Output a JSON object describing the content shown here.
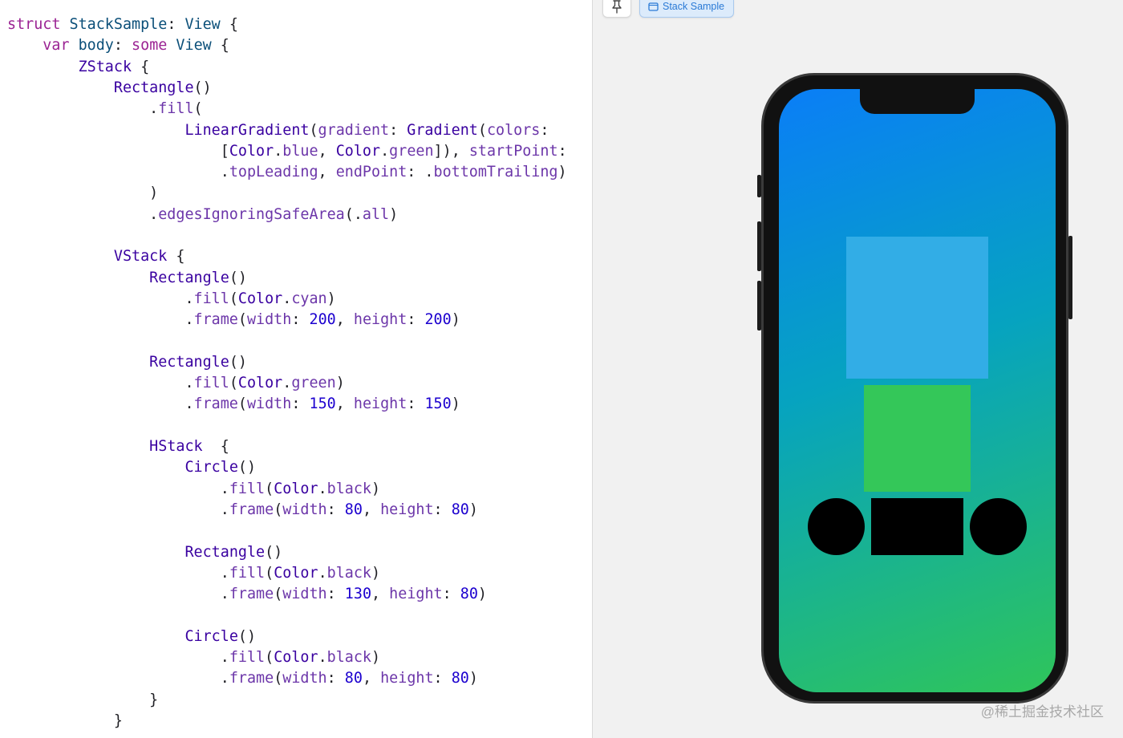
{
  "editor": {
    "lines": [
      [
        [
          "keyword",
          "struct"
        ],
        [
          "plain",
          " "
        ],
        [
          "type",
          "StackSample"
        ],
        [
          "plain",
          ": "
        ],
        [
          "type",
          "View"
        ],
        [
          "plain",
          " {"
        ]
      ],
      [
        [
          "plain",
          "    "
        ],
        [
          "keyword",
          "var"
        ],
        [
          "plain",
          " "
        ],
        [
          "type",
          "body"
        ],
        [
          "plain",
          ": "
        ],
        [
          "keyword",
          "some"
        ],
        [
          "plain",
          " "
        ],
        [
          "type",
          "View"
        ],
        [
          "plain",
          " {"
        ]
      ],
      [
        [
          "plain",
          "        "
        ],
        [
          "method",
          "ZStack"
        ],
        [
          "plain",
          " {"
        ]
      ],
      [
        [
          "plain",
          "            "
        ],
        [
          "method",
          "Rectangle"
        ],
        [
          "plain",
          "()"
        ]
      ],
      [
        [
          "plain",
          "                ."
        ],
        [
          "member",
          "fill"
        ],
        [
          "plain",
          "("
        ]
      ],
      [
        [
          "plain",
          "                    "
        ],
        [
          "method",
          "LinearGradient"
        ],
        [
          "plain",
          "("
        ],
        [
          "member",
          "gradient"
        ],
        [
          "plain",
          ": "
        ],
        [
          "method",
          "Gradient"
        ],
        [
          "plain",
          "("
        ],
        [
          "member",
          "colors"
        ],
        [
          "plain",
          ":"
        ]
      ],
      [
        [
          "plain",
          "                        ["
        ],
        [
          "method",
          "Color"
        ],
        [
          "plain",
          "."
        ],
        [
          "member",
          "blue"
        ],
        [
          "plain",
          ", "
        ],
        [
          "method",
          "Color"
        ],
        [
          "plain",
          "."
        ],
        [
          "member",
          "green"
        ],
        [
          "plain",
          "]), "
        ],
        [
          "member",
          "startPoint"
        ],
        [
          "plain",
          ":"
        ]
      ],
      [
        [
          "plain",
          "                        ."
        ],
        [
          "member",
          "topLeading"
        ],
        [
          "plain",
          ", "
        ],
        [
          "member",
          "endPoint"
        ],
        [
          "plain",
          ": ."
        ],
        [
          "member",
          "bottomTrailing"
        ],
        [
          "plain",
          ")"
        ]
      ],
      [
        [
          "plain",
          "                )"
        ]
      ],
      [
        [
          "plain",
          "                ."
        ],
        [
          "member",
          "edgesIgnoringSafeArea"
        ],
        [
          "plain",
          "(."
        ],
        [
          "member",
          "all"
        ],
        [
          "plain",
          ")"
        ]
      ],
      [
        [
          "plain",
          ""
        ]
      ],
      [
        [
          "plain",
          "            "
        ],
        [
          "method",
          "VStack"
        ],
        [
          "plain",
          " {"
        ]
      ],
      [
        [
          "plain",
          "                "
        ],
        [
          "method",
          "Rectangle"
        ],
        [
          "plain",
          "()"
        ]
      ],
      [
        [
          "plain",
          "                    ."
        ],
        [
          "member",
          "fill"
        ],
        [
          "plain",
          "("
        ],
        [
          "method",
          "Color"
        ],
        [
          "plain",
          "."
        ],
        [
          "member",
          "cyan"
        ],
        [
          "plain",
          ")"
        ]
      ],
      [
        [
          "plain",
          "                    ."
        ],
        [
          "member",
          "frame"
        ],
        [
          "plain",
          "("
        ],
        [
          "member",
          "width"
        ],
        [
          "plain",
          ": "
        ],
        [
          "number",
          "200"
        ],
        [
          "plain",
          ", "
        ],
        [
          "member",
          "height"
        ],
        [
          "plain",
          ": "
        ],
        [
          "number",
          "200"
        ],
        [
          "plain",
          ")"
        ]
      ],
      [
        [
          "plain",
          ""
        ]
      ],
      [
        [
          "plain",
          "                "
        ],
        [
          "method",
          "Rectangle"
        ],
        [
          "plain",
          "()"
        ]
      ],
      [
        [
          "plain",
          "                    ."
        ],
        [
          "member",
          "fill"
        ],
        [
          "plain",
          "("
        ],
        [
          "method",
          "Color"
        ],
        [
          "plain",
          "."
        ],
        [
          "member",
          "green"
        ],
        [
          "plain",
          ")"
        ]
      ],
      [
        [
          "plain",
          "                    ."
        ],
        [
          "member",
          "frame"
        ],
        [
          "plain",
          "("
        ],
        [
          "member",
          "width"
        ],
        [
          "plain",
          ": "
        ],
        [
          "number",
          "150"
        ],
        [
          "plain",
          ", "
        ],
        [
          "member",
          "height"
        ],
        [
          "plain",
          ": "
        ],
        [
          "number",
          "150"
        ],
        [
          "plain",
          ")"
        ]
      ],
      [
        [
          "plain",
          ""
        ]
      ],
      [
        [
          "plain",
          "                "
        ],
        [
          "method",
          "HStack"
        ],
        [
          "plain",
          "  {"
        ]
      ],
      [
        [
          "plain",
          "                    "
        ],
        [
          "method",
          "Circle"
        ],
        [
          "plain",
          "()"
        ]
      ],
      [
        [
          "plain",
          "                        ."
        ],
        [
          "member",
          "fill"
        ],
        [
          "plain",
          "("
        ],
        [
          "method",
          "Color"
        ],
        [
          "plain",
          "."
        ],
        [
          "member",
          "black"
        ],
        [
          "plain",
          ")"
        ]
      ],
      [
        [
          "plain",
          "                        ."
        ],
        [
          "member",
          "frame"
        ],
        [
          "plain",
          "("
        ],
        [
          "member",
          "width"
        ],
        [
          "plain",
          ": "
        ],
        [
          "number",
          "80"
        ],
        [
          "plain",
          ", "
        ],
        [
          "member",
          "height"
        ],
        [
          "plain",
          ": "
        ],
        [
          "number",
          "80"
        ],
        [
          "plain",
          ")"
        ]
      ],
      [
        [
          "plain",
          ""
        ]
      ],
      [
        [
          "plain",
          "                    "
        ],
        [
          "method",
          "Rectangle"
        ],
        [
          "plain",
          "()"
        ]
      ],
      [
        [
          "plain",
          "                        ."
        ],
        [
          "member",
          "fill"
        ],
        [
          "plain",
          "("
        ],
        [
          "method",
          "Color"
        ],
        [
          "plain",
          "."
        ],
        [
          "member",
          "black"
        ],
        [
          "plain",
          ")"
        ]
      ],
      [
        [
          "plain",
          "                        ."
        ],
        [
          "member",
          "frame"
        ],
        [
          "plain",
          "("
        ],
        [
          "member",
          "width"
        ],
        [
          "plain",
          ": "
        ],
        [
          "number",
          "130"
        ],
        [
          "plain",
          ", "
        ],
        [
          "member",
          "height"
        ],
        [
          "plain",
          ": "
        ],
        [
          "number",
          "80"
        ],
        [
          "plain",
          ")"
        ]
      ],
      [
        [
          "plain",
          ""
        ]
      ],
      [
        [
          "plain",
          "                    "
        ],
        [
          "method",
          "Circle"
        ],
        [
          "plain",
          "()"
        ]
      ],
      [
        [
          "plain",
          "                        ."
        ],
        [
          "member",
          "fill"
        ],
        [
          "plain",
          "("
        ],
        [
          "method",
          "Color"
        ],
        [
          "plain",
          "."
        ],
        [
          "member",
          "black"
        ],
        [
          "plain",
          ")"
        ]
      ],
      [
        [
          "plain",
          "                        ."
        ],
        [
          "member",
          "frame"
        ],
        [
          "plain",
          "("
        ],
        [
          "member",
          "width"
        ],
        [
          "plain",
          ": "
        ],
        [
          "number",
          "80"
        ],
        [
          "plain",
          ", "
        ],
        [
          "member",
          "height"
        ],
        [
          "plain",
          ": "
        ],
        [
          "number",
          "80"
        ],
        [
          "plain",
          ")"
        ]
      ],
      [
        [
          "plain",
          "                }"
        ]
      ],
      [
        [
          "plain",
          "            }"
        ]
      ]
    ]
  },
  "canvas": {
    "pin_icon": "pin-icon",
    "preview_tab_icon": "device-icon",
    "preview_tab_label": "Stack Sample"
  },
  "preview": {
    "gradient_start_color": "#0a7ef7",
    "gradient_end_color": "#2fc55a",
    "cyan_color": "#32ade6",
    "green_color": "#34c759",
    "shape_color": "#000000"
  },
  "watermark": "@稀土掘金技术社区"
}
